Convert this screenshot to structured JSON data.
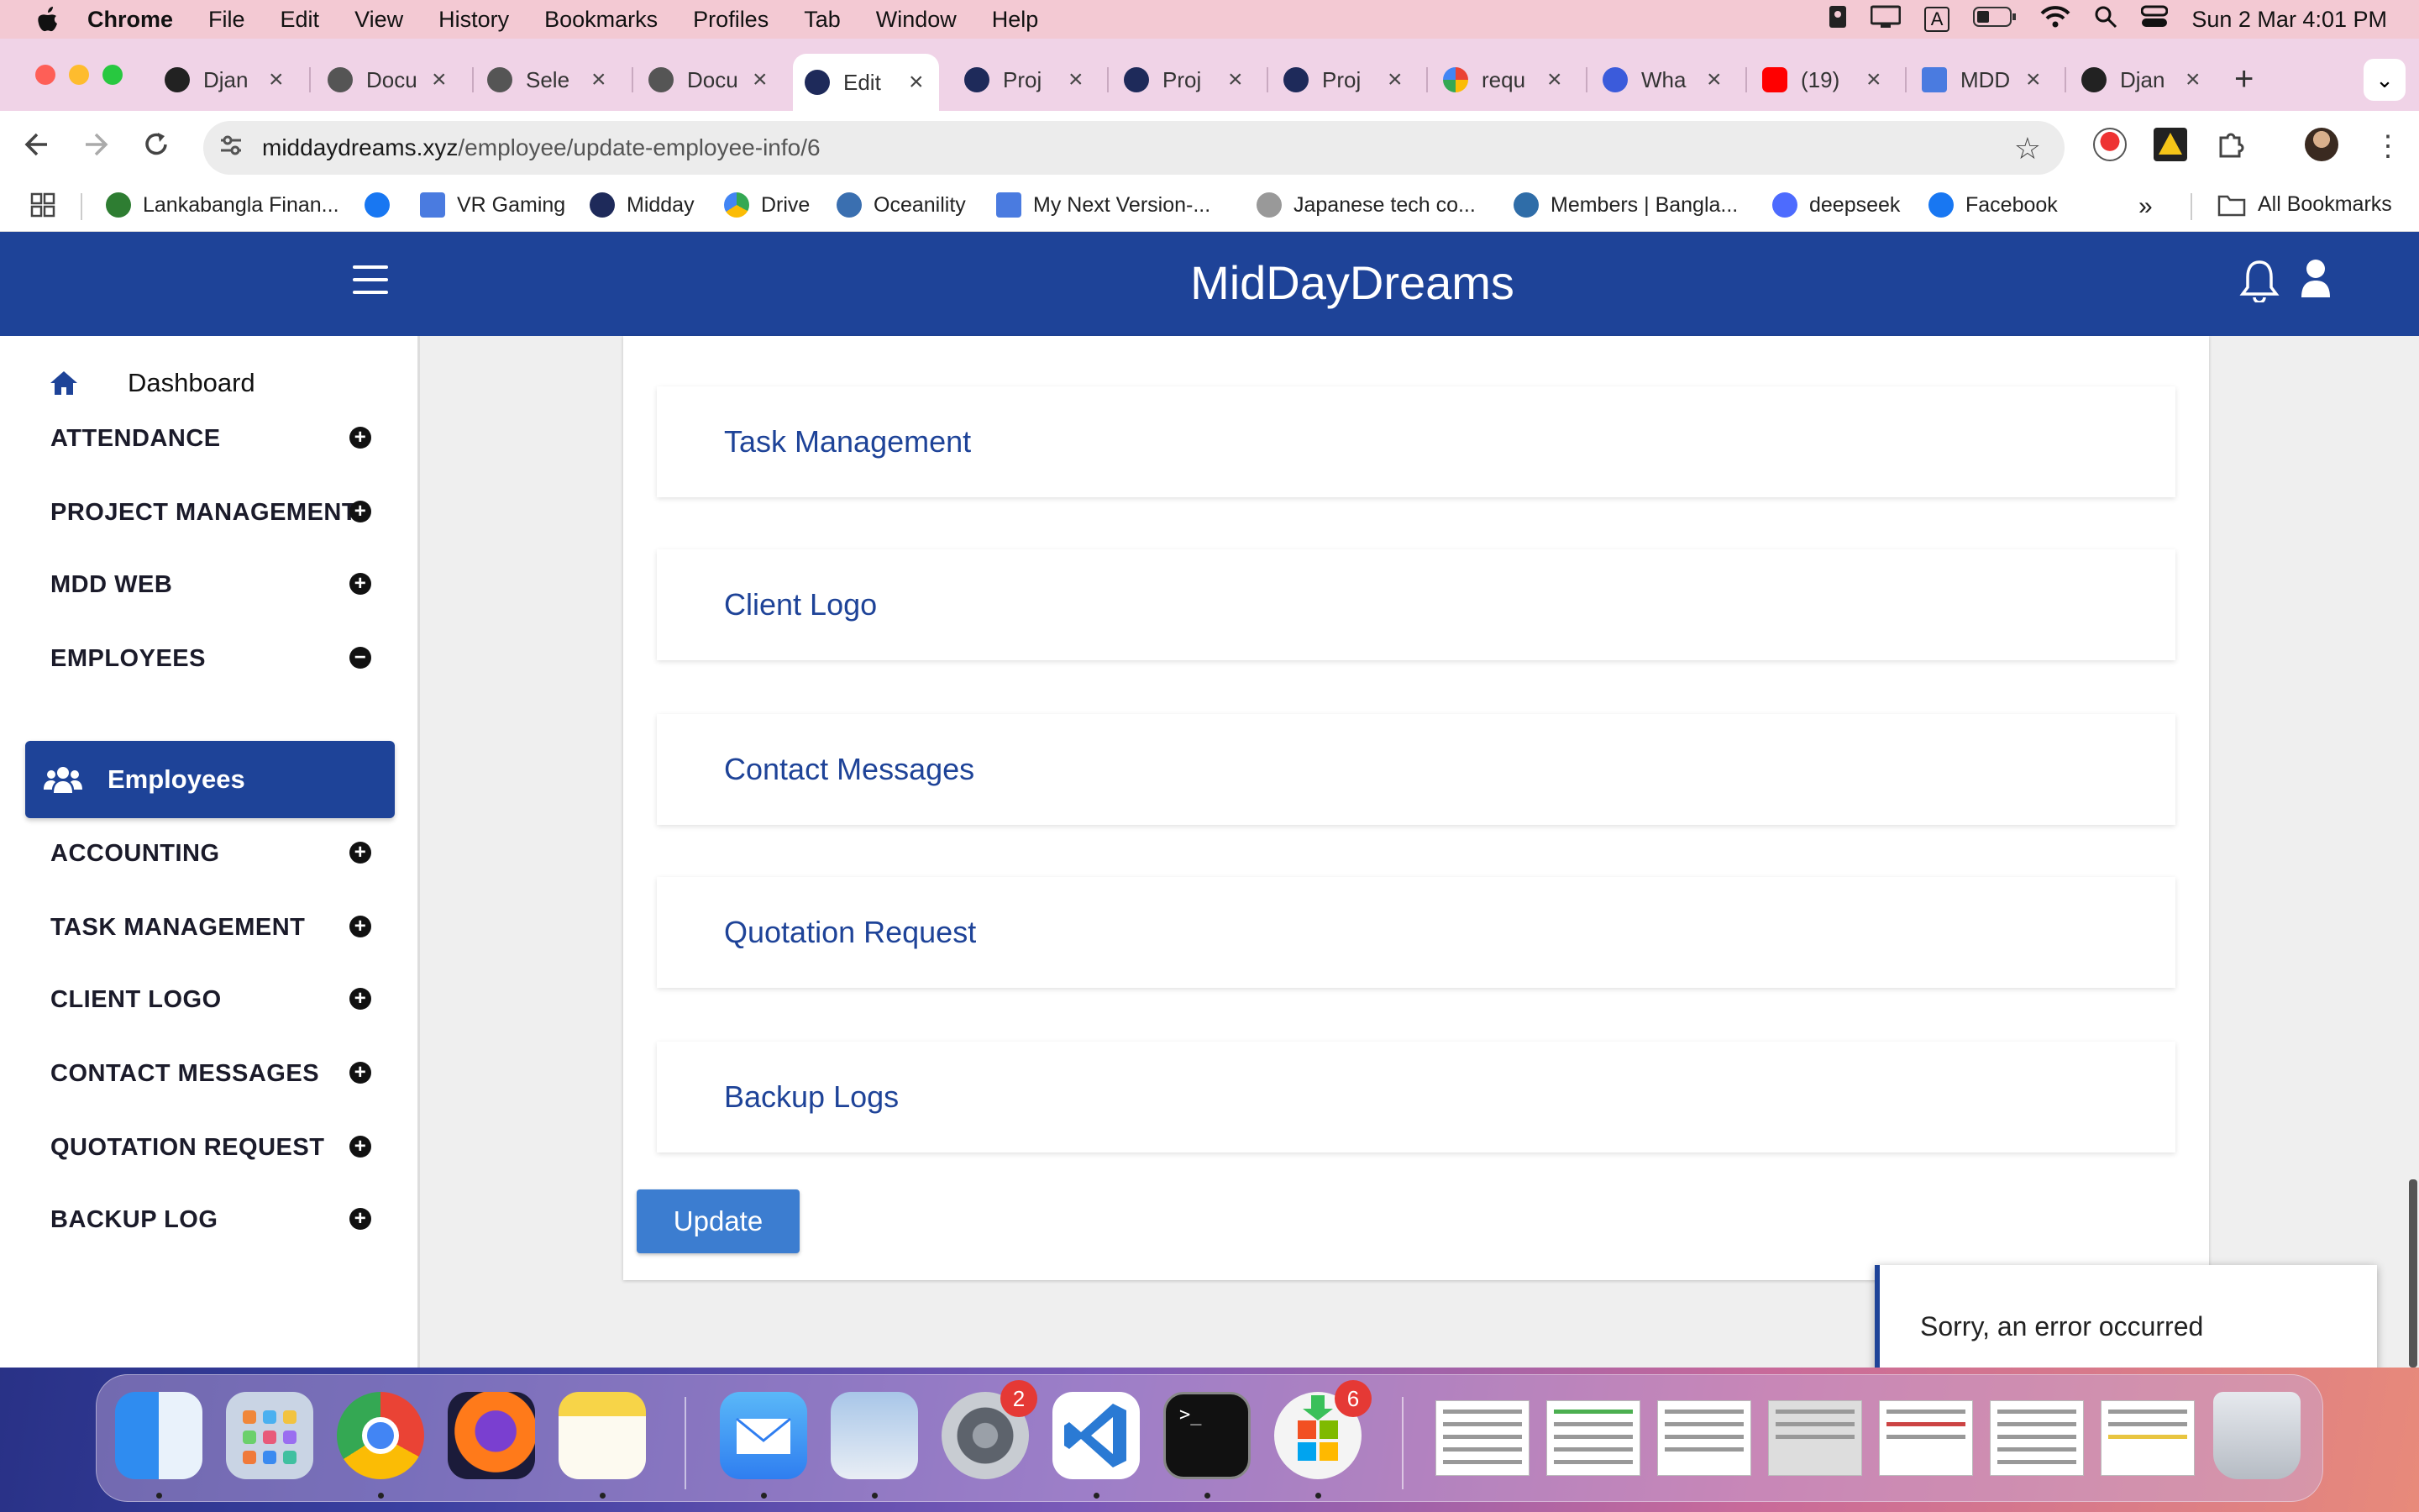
{
  "menubar": {
    "app_name": "Chrome",
    "menus": [
      "File",
      "Edit",
      "View",
      "History",
      "Bookmarks",
      "Profiles",
      "Tab",
      "Window",
      "Help"
    ],
    "datetime": "Sun 2 Mar  4:01 PM",
    "input_indicator": "A"
  },
  "tabs": [
    {
      "label": "Djan",
      "icon": "django-icon"
    },
    {
      "label": "Docu",
      "icon": "globe-icon"
    },
    {
      "label": "Sele",
      "icon": "globe-icon"
    },
    {
      "label": "Docu",
      "icon": "globe-icon"
    },
    {
      "label": "Edit",
      "icon": "middaydreams-icon"
    },
    {
      "label": "Proj",
      "icon": "middaydreams-icon"
    },
    {
      "label": "Proj",
      "icon": "middaydreams-icon"
    },
    {
      "label": "Proj",
      "icon": "middaydreams-icon"
    },
    {
      "label": "requ",
      "icon": "google-icon"
    },
    {
      "label": "Wha",
      "icon": "chatgpt-icon"
    },
    {
      "label": "(19)",
      "icon": "youtube-icon"
    },
    {
      "label": "MDD",
      "icon": "docs-icon"
    },
    {
      "label": "Djan",
      "icon": "django-icon"
    }
  ],
  "address": {
    "host": "middaydreams.xyz",
    "path": "/employee/update-employee-info/6"
  },
  "bookmarks": [
    {
      "label": "Lankabangla Finan...",
      "color": "#2e7d32"
    },
    {
      "label": "",
      "color": "#1877f2"
    },
    {
      "label": "VR Gaming",
      "color": "#4a7be0"
    },
    {
      "label": "Midday",
      "color": "#1e2a5a"
    },
    {
      "label": "Drive",
      "color": "#34a853"
    },
    {
      "label": "Oceanility",
      "color": "#3a6fb0"
    },
    {
      "label": "My Next Version-...",
      "color": "#4a7be0"
    },
    {
      "label": "Japanese tech co...",
      "color": "#777777"
    },
    {
      "label": "Members | Bangla...",
      "color": "#2f6da8"
    },
    {
      "label": "deepseek",
      "color": "#4d6bfe"
    },
    {
      "label": "Facebook",
      "color": "#1877f2"
    }
  ],
  "all_bookmarks": "All Bookmarks",
  "app": {
    "brand": "MidDayDreams"
  },
  "sidebar": {
    "dashboard": "Dashboard",
    "items": [
      {
        "label": "ATTENDANCE",
        "state": "plus"
      },
      {
        "label": "PROJECT MANAGEMENT",
        "state": "plus"
      },
      {
        "label": "MDD WEB",
        "state": "plus"
      },
      {
        "label": "EMPLOYEES",
        "state": "minus"
      },
      {
        "label": "ACCOUNTING",
        "state": "plus"
      },
      {
        "label": "TASK MANAGEMENT",
        "state": "plus"
      },
      {
        "label": "CLIENT LOGO",
        "state": "plus"
      },
      {
        "label": "CONTACT MESSAGES",
        "state": "plus"
      },
      {
        "label": "QUOTATION REQUEST",
        "state": "plus"
      },
      {
        "label": "BACKUP LOG",
        "state": "plus"
      }
    ],
    "active_sub": "Employees",
    "plus_symbol": "+",
    "minus_symbol": "−"
  },
  "permissions": [
    "Task Management",
    "Client Logo",
    "Contact Messages",
    "Quotation Request",
    "Backup Logs"
  ],
  "update_label": "Update",
  "toast": "Sorry, an error occurred",
  "dock": {
    "badges": {
      "settings": "2",
      "store": "6"
    }
  },
  "colors": {
    "primary": "#1e4398",
    "button": "#3c7dd0"
  }
}
